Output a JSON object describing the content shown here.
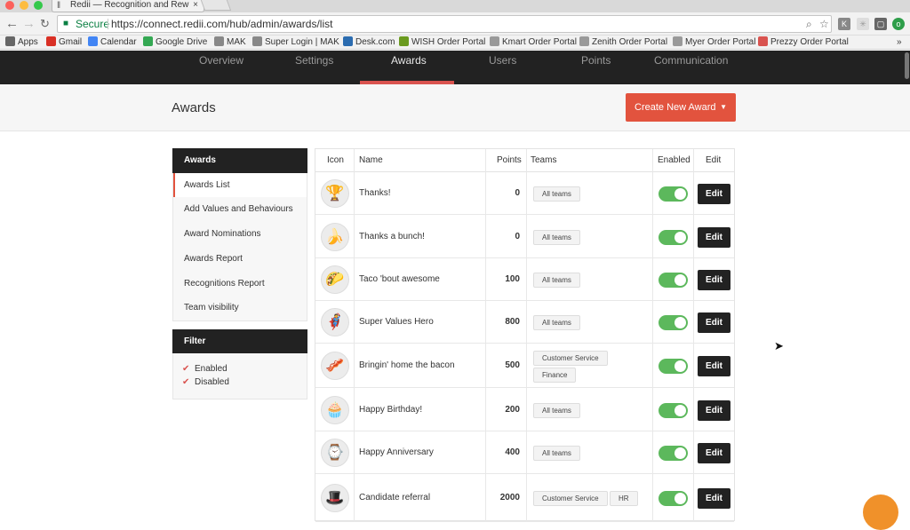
{
  "browser": {
    "tab_title": "Redii — Recognition and Rew",
    "tab_close": "×",
    "secure_label": "Secure",
    "url": "https://connect.redii.com/hub/admin/awards/list",
    "bookmarks": [
      {
        "label": "Apps",
        "icon": "apps-grid-icon",
        "color": "#666666"
      },
      {
        "label": "Gmail",
        "icon": "gmail-icon",
        "color": "#d93025"
      },
      {
        "label": "Calendar",
        "icon": "calendar-icon",
        "color": "#4285f4"
      },
      {
        "label": "Google Drive",
        "icon": "drive-icon",
        "color": "#34a853"
      },
      {
        "label": "MAK",
        "icon": "page-icon",
        "color": "#888888"
      },
      {
        "label": "Super Login | MAK",
        "icon": "page-icon",
        "color": "#888888"
      },
      {
        "label": "Desk.com",
        "icon": "desk-icon",
        "color": "#2b6cb0"
      },
      {
        "label": "WISH Order Portal",
        "icon": "wish-icon",
        "color": "#6a9a1f"
      },
      {
        "label": "Kmart Order Portal",
        "icon": "doc-icon",
        "color": "#999999"
      },
      {
        "label": "Zenith Order Portal",
        "icon": "doc-icon",
        "color": "#999999"
      },
      {
        "label": "Myer Order Portal",
        "icon": "doc-icon",
        "color": "#999999"
      },
      {
        "label": "Prezzy Order Portal",
        "icon": "prezzy-icon",
        "color": "#d9534f"
      }
    ],
    "overflow": "»"
  },
  "nav": {
    "items": [
      "Overview",
      "Settings",
      "Awards",
      "Users",
      "Points",
      "Communication"
    ],
    "active": "Awards",
    "accent": "#d9534f"
  },
  "header": {
    "title": "Awards",
    "create_button": "Create New Award",
    "button_color": "#e2533e"
  },
  "sidebar": {
    "section_title": "Awards",
    "items": [
      "Awards List",
      "Add Values and Behaviours",
      "Award Nominations",
      "Awards Report",
      "Recognitions Report",
      "Team visibility"
    ],
    "active_item": "Awards List",
    "filter_title": "Filter",
    "filters": [
      {
        "label": "Enabled",
        "checked": true
      },
      {
        "label": "Disabled",
        "checked": true
      }
    ]
  },
  "table": {
    "columns": [
      "Icon",
      "Name",
      "Points",
      "Teams",
      "Enabled",
      "Edit"
    ],
    "edit_label": "Edit",
    "rows": [
      {
        "icon": "trophy-icon",
        "glyph": "🏆",
        "name": "Thanks!",
        "points": "0",
        "teams": [
          "All teams"
        ],
        "enabled": true
      },
      {
        "icon": "banana-icon",
        "glyph": "🍌",
        "name": "Thanks a bunch!",
        "points": "0",
        "teams": [
          "All teams"
        ],
        "enabled": true
      },
      {
        "icon": "taco-icon",
        "glyph": "🌮",
        "name": "Taco 'bout awesome",
        "points": "100",
        "teams": [
          "All teams"
        ],
        "enabled": true
      },
      {
        "icon": "superhero-icon",
        "glyph": "🦸",
        "name": "Super Values Hero",
        "points": "800",
        "teams": [
          "All teams"
        ],
        "enabled": true
      },
      {
        "icon": "bacon-heart-icon",
        "glyph": "🥓",
        "name": "Bringin' home the bacon",
        "points": "500",
        "teams": [
          "Customer Service",
          "Finance"
        ],
        "enabled": true
      },
      {
        "icon": "cupcake-icon",
        "glyph": "🧁",
        "name": "Happy Birthday!",
        "points": "200",
        "teams": [
          "All teams"
        ],
        "enabled": true
      },
      {
        "icon": "watch-icon",
        "glyph": "⌚",
        "name": "Happy Anniversary",
        "points": "400",
        "teams": [
          "All teams"
        ],
        "enabled": true
      },
      {
        "icon": "hat-icon",
        "glyph": "🎩",
        "name": "Candidate referral",
        "points": "2000",
        "teams": [
          "Customer Service",
          "HR"
        ],
        "enabled": true
      }
    ]
  }
}
